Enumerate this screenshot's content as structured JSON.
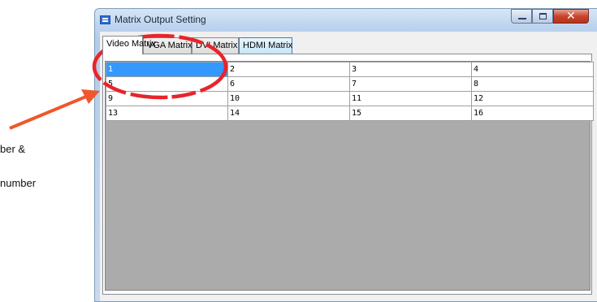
{
  "annotation": {
    "line1": "ber &",
    "line2": "number"
  },
  "window": {
    "title": "Matrix Output Setting"
  },
  "tabs": [
    {
      "label": "Video Matrix"
    },
    {
      "label": "VGA Matrix"
    },
    {
      "label": "DVI Matrix"
    },
    {
      "label": "HDMI Matrix"
    }
  ],
  "grid": {
    "rows": [
      [
        "1",
        "2",
        "3",
        "4"
      ],
      [
        "5",
        "6",
        "7",
        "8"
      ],
      [
        "9",
        "10",
        "11",
        "12"
      ],
      [
        "13",
        "14",
        "15",
        "16"
      ]
    ],
    "selected": "1"
  },
  "colors": {
    "selection": "#3399ff",
    "highlight": "#e8242b",
    "arrow": "#f0572a",
    "empty_area": "#ababab"
  }
}
